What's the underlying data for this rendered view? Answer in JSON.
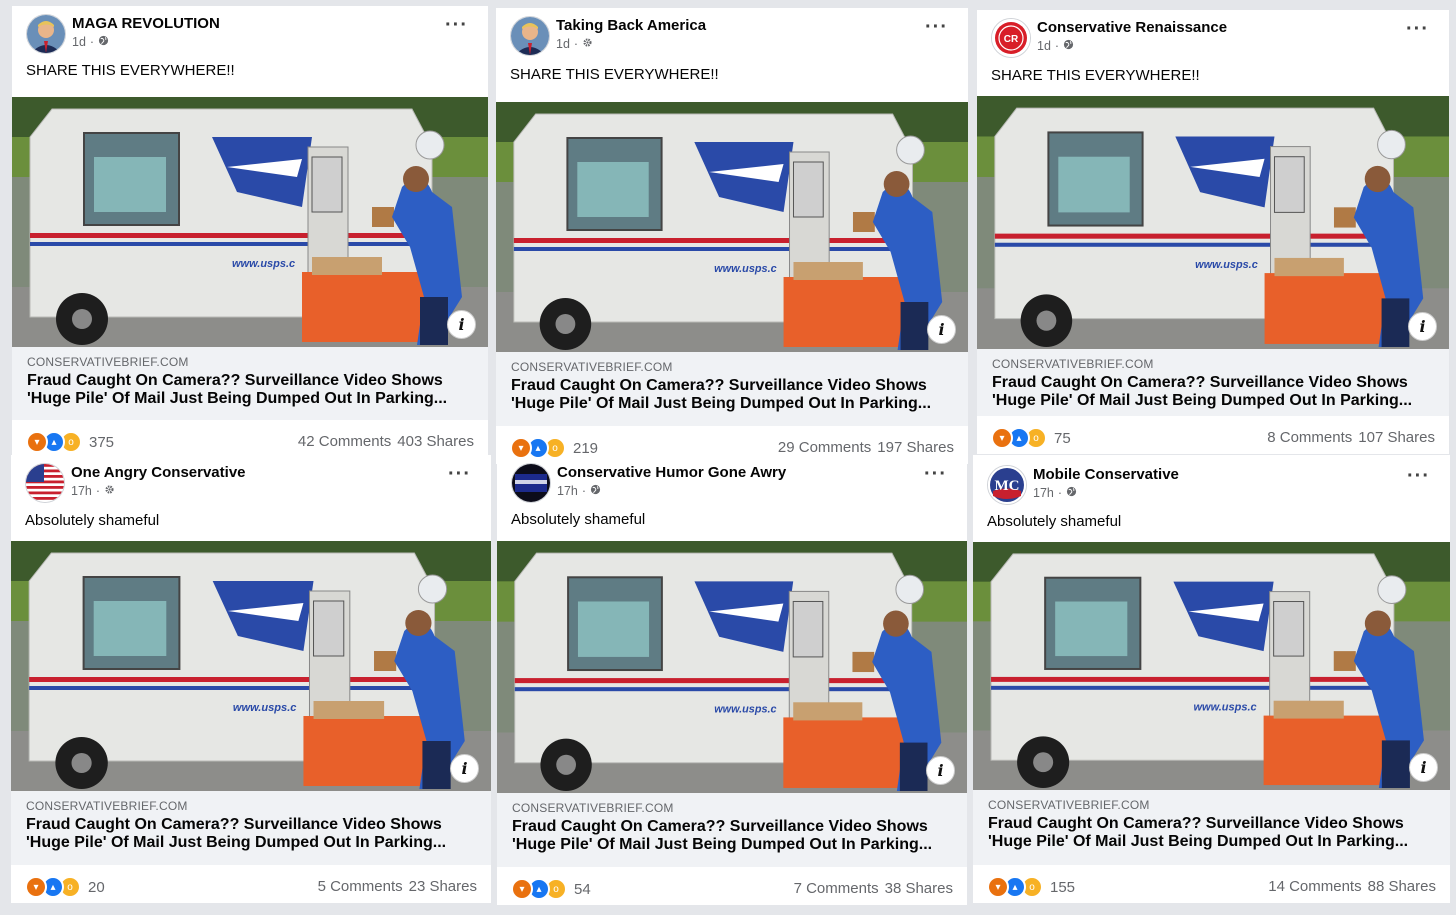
{
  "posts": [
    {
      "page_name": "MAGA REVOLUTION",
      "time": "1d",
      "audience_icon": "globe-icon",
      "text": "SHARE THIS EVERYWHERE!!",
      "domain": "CONSERVATIVEBRIEF.COM",
      "headline": "Fraud Caught On Camera?? Surveillance Video Shows 'Huge Pile' Of Mail Just Being Dumped Out In Parking...",
      "reaction_count": "375",
      "comments": "42 Comments",
      "shares": "403 Shares"
    },
    {
      "page_name": "Taking Back America",
      "time": "1d",
      "audience_icon": "gear-icon",
      "text": "SHARE THIS EVERYWHERE!!",
      "domain": "CONSERVATIVEBRIEF.COM",
      "headline": "Fraud Caught On Camera?? Surveillance Video Shows 'Huge Pile' Of Mail Just Being Dumped Out In Parking...",
      "reaction_count": "219",
      "comments": "29 Comments",
      "shares": "197 Shares"
    },
    {
      "page_name": "Conservative Renaissance",
      "time": "1d",
      "audience_icon": "globe-icon",
      "text": "SHARE THIS EVERYWHERE!!",
      "domain": "CONSERVATIVEBRIEF.COM",
      "headline": "Fraud Caught On Camera?? Surveillance Video Shows 'Huge Pile' Of Mail Just Being Dumped Out In Parking...",
      "reaction_count": "75",
      "comments": "8 Comments",
      "shares": "107 Shares",
      "avatar_text": "CR"
    },
    {
      "page_name": "One Angry Conservative",
      "time": "17h",
      "audience_icon": "gear-icon",
      "text": "Absolutely shameful",
      "domain": "CONSERVATIVEBRIEF.COM",
      "headline": "Fraud Caught On Camera?? Surveillance Video Shows 'Huge Pile' Of Mail Just Being Dumped Out In Parking...",
      "reaction_count": "20",
      "comments": "5 Comments",
      "shares": "23 Shares"
    },
    {
      "page_name": "Conservative Humor Gone Awry",
      "time": "17h",
      "audience_icon": "globe-icon",
      "text": "Absolutely shameful",
      "domain": "CONSERVATIVEBRIEF.COM",
      "headline": "Fraud Caught On Camera?? Surveillance Video Shows 'Huge Pile' Of Mail Just Being Dumped Out In Parking...",
      "reaction_count": "54",
      "comments": "7 Comments",
      "shares": "38 Shares"
    },
    {
      "page_name": "Mobile Conservative",
      "time": "17h",
      "audience_icon": "globe-icon",
      "text": "Absolutely shameful",
      "domain": "CONSERVATIVEBRIEF.COM",
      "headline": "Fraud Caught On Camera?? Surveillance Video Shows 'Huge Pile' Of Mail Just Being Dumped Out In Parking...",
      "reaction_count": "155",
      "comments": "14 Comments",
      "shares": "88 Shares",
      "avatar_text": "MC"
    }
  ],
  "photo_text": "www.usps.c",
  "colors": {
    "usps_blue": "#2a4aa8",
    "usps_red": "#c8202e",
    "bin_orange": "#e8602a",
    "reaction_angry": "#e9710f",
    "reaction_like": "#1877f2",
    "reaction_wow": "#f7b125"
  }
}
